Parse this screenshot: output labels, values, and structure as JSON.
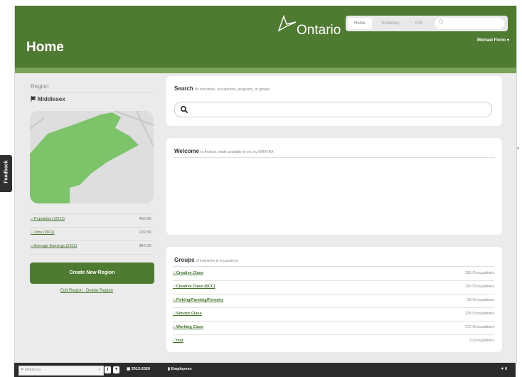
{
  "header": {
    "page_title": "Home",
    "logo_text": "Ontario",
    "nav": [
      "Home",
      "Economy",
      "GIS"
    ],
    "search_icon": "Q",
    "user_name": "Michael Florio ▾"
  },
  "feedback_label": "Feedback",
  "sidebar": {
    "region_label": "Region",
    "region_name": "Middlesex",
    "stats": [
      {
        "label": "Population (2011)",
        "value": "460.9K"
      },
      {
        "label": "Jobs (2011)",
        "value": "220.5K"
      },
      {
        "label": "Average Earnings (2011)",
        "value": "$42.0K"
      }
    ],
    "create_button": "Create New Region",
    "edit_link": "Edit Region",
    "delete_link": "Delete Region"
  },
  "search_card": {
    "title": "Search",
    "subtitle": "for industries, occupations, programs, or groups",
    "icon": "search-icon"
  },
  "welcome_card": {
    "title": "Welcome",
    "subtitle": "to Analyst, made available to you by OMAFRA"
  },
  "groups_card": {
    "title": "Groups",
    "subtitle": "of industries & occupations",
    "rows": [
      {
        "name": "Creative Class",
        "count": "195 Occupations"
      },
      {
        "name": "Creative Class (SCC)",
        "count": "120 Occupations"
      },
      {
        "name": "Fishing/Farming/Forestry",
        "count": "29 Occupations"
      },
      {
        "name": "Service Class",
        "count": "125 Occupations"
      },
      {
        "name": "Working Class",
        "count": "172 Occupations"
      },
      {
        "name": "test",
        "count": "3 Occupations"
      }
    ]
  },
  "bottom_bar": {
    "region_select": "Middlesex",
    "select_arrow": "▾",
    "btn_info": "i",
    "btn_add": "+",
    "years": "2013-2020",
    "metric": "Employees",
    "count": "0"
  },
  "colors": {
    "brand_green": "#4f7a32",
    "map_green": "#7cc36a",
    "link_green": "#3e6e26"
  }
}
